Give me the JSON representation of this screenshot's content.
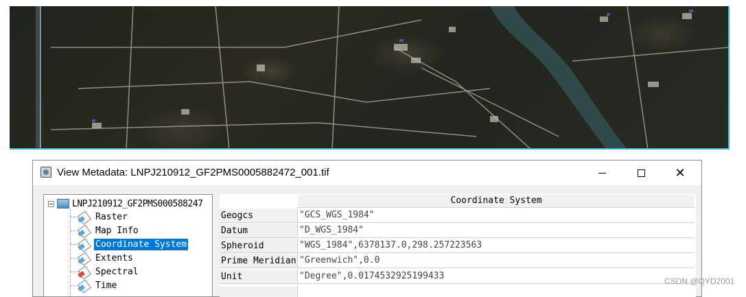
{
  "window": {
    "title": "View Metadata: LNPJ210912_GF2PMS0005882472_001.tif",
    "controls": {
      "minimize_icon": "minimize-icon",
      "maximize_icon": "maximize-icon",
      "close_icon": "close-icon"
    }
  },
  "tree": {
    "root_label": "LNPJ210912_GF2PMS000588247",
    "items": [
      {
        "label": "Raster",
        "icon": "document-icon"
      },
      {
        "label": "Map Info",
        "icon": "document-icon"
      },
      {
        "label": "Coordinate System",
        "icon": "document-icon",
        "selected": true
      },
      {
        "label": "Extents",
        "icon": "document-icon"
      },
      {
        "label": "Spectral",
        "icon": "spectral-icon"
      },
      {
        "label": "Time",
        "icon": "document-icon"
      }
    ]
  },
  "table": {
    "header": "Coordinate System",
    "rows": [
      {
        "key": "Geogcs",
        "value": "\"GCS_WGS_1984\""
      },
      {
        "key": "Datum",
        "value": "\"D_WGS_1984\""
      },
      {
        "key": "Spheroid",
        "value": "\"WGS_1984\",6378137.0,298.257223563"
      },
      {
        "key": "Prime Meridian",
        "value": "\"Greenwich\",0.0"
      },
      {
        "key": "Unit",
        "value": "\"Degree\",0.0174532925199433"
      }
    ]
  },
  "colors": {
    "selection": "#0078d7",
    "image_border": "#36c0d8"
  },
  "watermark": "CSDN @QYD2001"
}
